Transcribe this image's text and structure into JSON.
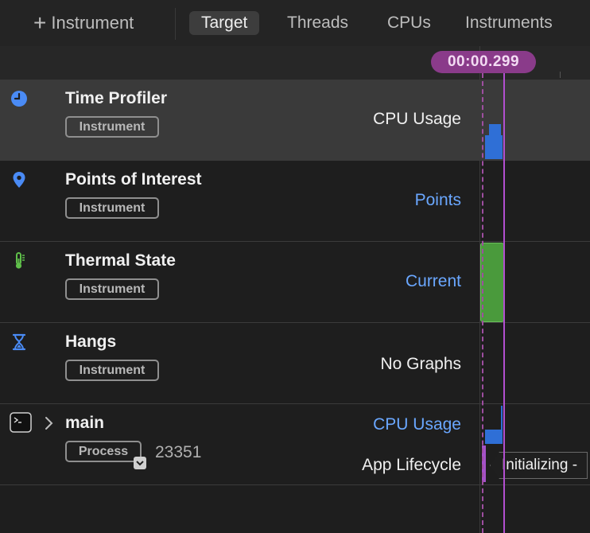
{
  "toolbar": {
    "add_label": "Instrument",
    "tabs": [
      {
        "label": "Target",
        "active": true
      },
      {
        "label": "Threads",
        "active": false
      },
      {
        "label": "CPUs",
        "active": false
      },
      {
        "label": "Instruments",
        "active": false
      }
    ]
  },
  "timeline": {
    "playhead_time": "00:00.299"
  },
  "rows": [
    {
      "name": "Time Profiler",
      "badge": "Instrument",
      "metric": "CPU Usage",
      "metric_color": "white",
      "icon": "clock-icon"
    },
    {
      "name": "Points of Interest",
      "badge": "Instrument",
      "metric": "Points",
      "metric_color": "blue",
      "icon": "pin-icon"
    },
    {
      "name": "Thermal State",
      "badge": "Instrument",
      "metric": "Current",
      "metric_color": "blue",
      "icon": "thermometer-icon"
    },
    {
      "name": "Hangs",
      "badge": "Instrument",
      "metric": "No Graphs",
      "metric_color": "white",
      "icon": "hourglass-icon"
    },
    {
      "name": "main",
      "badge": "Process",
      "pid": "23351",
      "metric": "CPU Usage",
      "metric2": "App Lifecycle",
      "icon": "terminal-icon"
    }
  ],
  "lifecycle": {
    "event_label": "Initializing -"
  },
  "colors": {
    "accent_purple": "#8a3b8a",
    "cpu_blue": "#2f6fd6",
    "thermal_green": "#4a9a3c",
    "link_blue": "#6aa7ff"
  }
}
